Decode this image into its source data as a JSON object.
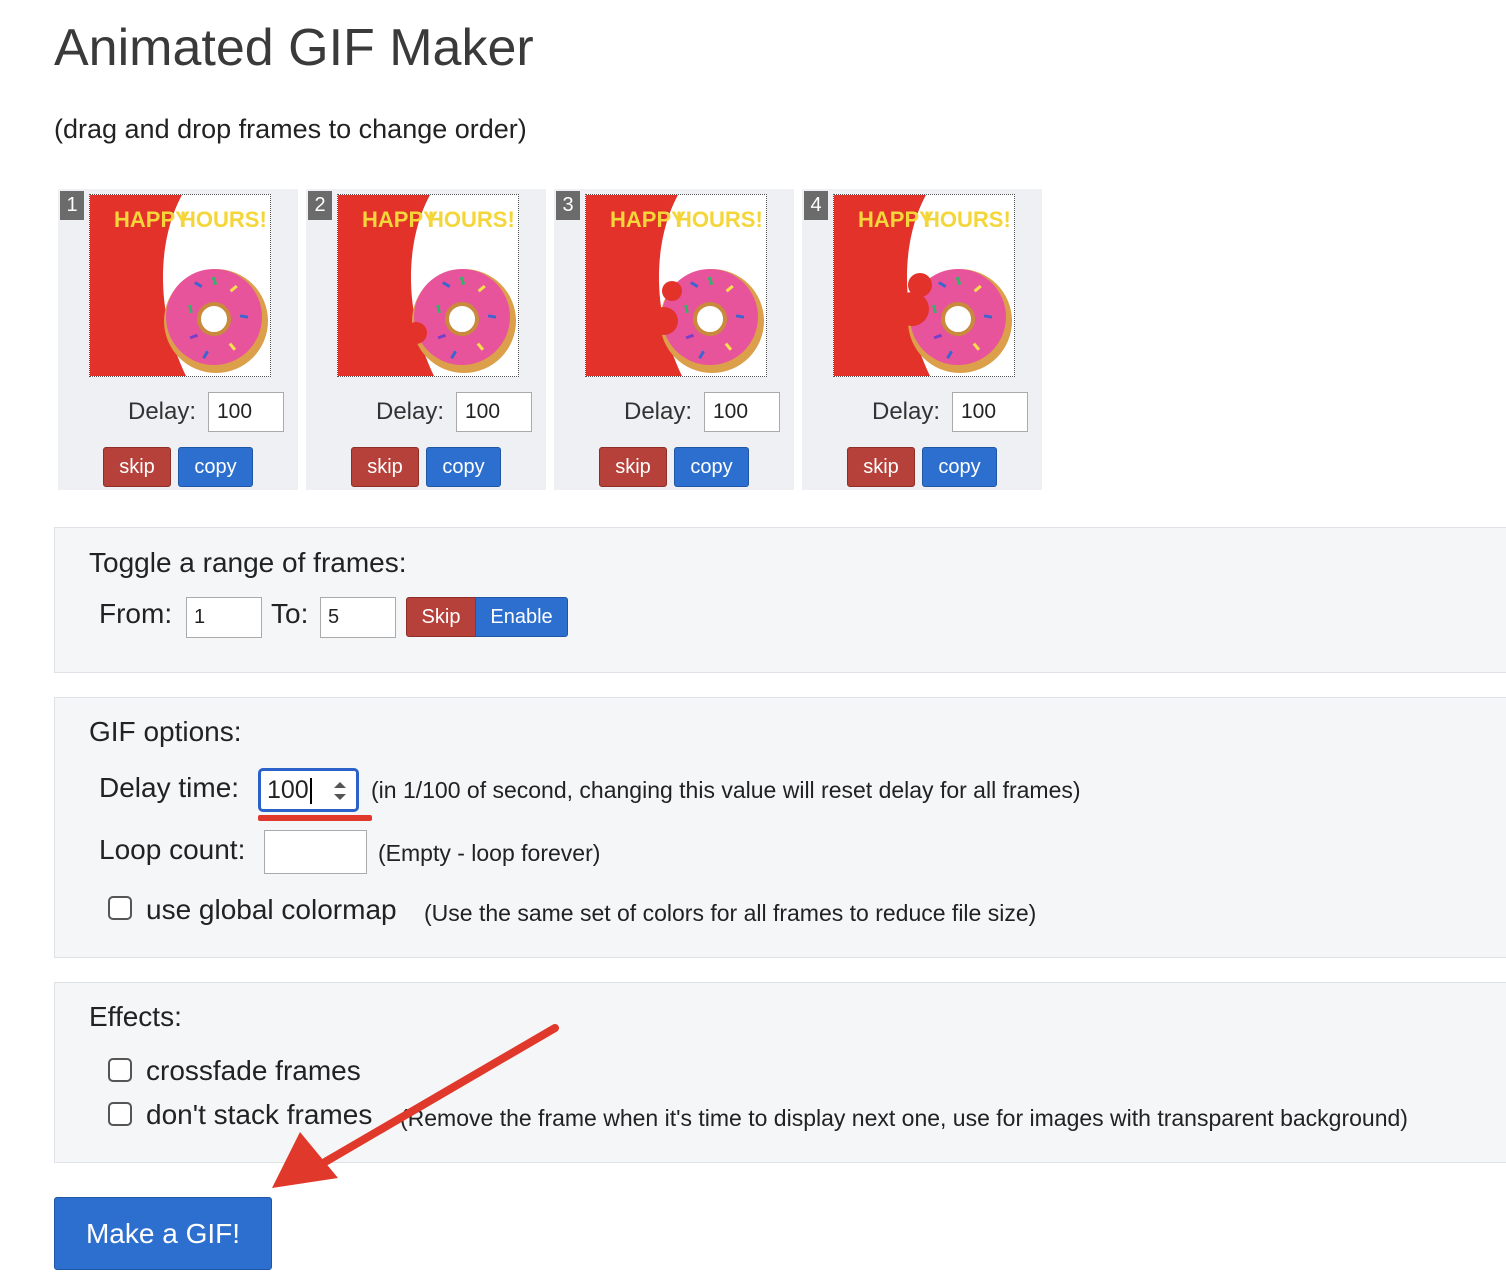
{
  "page": {
    "title": "Animated GIF Maker",
    "hint": "(drag and drop frames to change order)"
  },
  "frames": [
    {
      "number": "1",
      "caption_a": "HAPPY",
      "caption_b": "HOURS!",
      "delay_label": "Delay:",
      "delay": "100",
      "skip_label": "skip",
      "copy_label": "copy"
    },
    {
      "number": "2",
      "caption_a": "HAPPY",
      "caption_b": "HOURS!",
      "delay_label": "Delay:",
      "delay": "100",
      "skip_label": "skip",
      "copy_label": "copy"
    },
    {
      "number": "3",
      "caption_a": "HAPPY",
      "caption_b": "HOURS!",
      "delay_label": "Delay:",
      "delay": "100",
      "skip_label": "skip",
      "copy_label": "copy"
    },
    {
      "number": "4",
      "caption_a": "HAPPY",
      "caption_b": "HOURS!",
      "delay_label": "Delay:",
      "delay": "100",
      "skip_label": "skip",
      "copy_label": "copy"
    }
  ],
  "range": {
    "title": "Toggle a range of frames:",
    "from_label": "From:",
    "from_value": "1",
    "to_label": "To:",
    "to_value": "5",
    "skip_label": "Skip",
    "enable_label": "Enable"
  },
  "gif_options": {
    "title": "GIF options:",
    "delay_label": "Delay time:",
    "delay_value": "100",
    "delay_note": "(in 1/100 of second, changing this value will reset delay for all frames)",
    "loop_label": "Loop count:",
    "loop_value": "",
    "loop_note": "(Empty - loop forever)",
    "colormap_label": "use global colormap",
    "colormap_note": "(Use the same set of colors for all frames to reduce file size)",
    "colormap_checked": false
  },
  "effects": {
    "title": "Effects:",
    "crossfade_label": "crossfade frames",
    "crossfade_checked": false,
    "nostack_label": "don't stack frames",
    "nostack_note": "(Remove the frame when it's time to display next one, use for images with transparent background)",
    "nostack_checked": false
  },
  "make_button": "Make a GIF!",
  "colors": {
    "skip_red": "#b5413a",
    "primary_blue": "#2d6fcf",
    "annotation_red": "#e0392b",
    "panel_bg": "#f5f6f8"
  },
  "icons": {
    "spinner": "spinner-arrows-icon",
    "annotation": "red-arrow-annotation"
  }
}
